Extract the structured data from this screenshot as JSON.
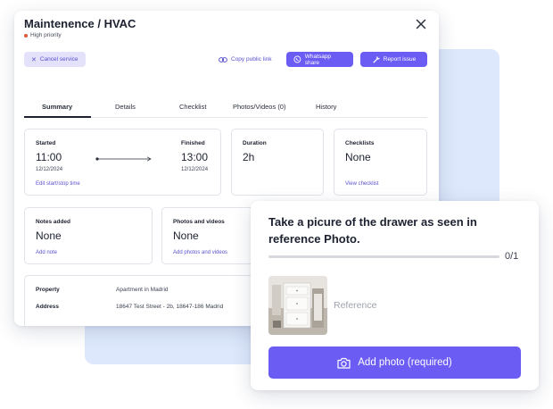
{
  "main": {
    "title": "Maintenence / HVAC",
    "priority": "High priority",
    "colors": {
      "accent": "#6b5cf3",
      "priority_dot": "#e0563a"
    },
    "actions": {
      "cancel": "Cancel service",
      "copy_link": "Copy public link",
      "whatsapp": "Whatsapp share",
      "report": "Report issue"
    },
    "tabs": [
      {
        "label": "Summary",
        "active": true
      },
      {
        "label": "Details",
        "active": false
      },
      {
        "label": "Checklist",
        "active": false
      },
      {
        "label": "Photos/Videos (0)",
        "active": false
      },
      {
        "label": "History",
        "active": false
      }
    ],
    "timing": {
      "started_label": "Started",
      "started_time": "11:00",
      "started_date": "12/12/2024",
      "finished_label": "Finished",
      "finished_time": "13:00",
      "finished_date": "12/12/2024",
      "edit_link": "Edit start/stop time"
    },
    "duration": {
      "label": "Duration",
      "value": "2h"
    },
    "checklists": {
      "label": "Checklists",
      "value": "None",
      "link": "View checklist"
    },
    "notes": {
      "label": "Notes added",
      "value": "None",
      "link": "Add note"
    },
    "photos": {
      "label": "Photos and videos",
      "value": "None",
      "link": "Add photos and videos"
    },
    "info": {
      "property_label": "Property",
      "property_value": "Apartment in Madrid",
      "address_label": "Address",
      "address_value": "18647 Test Street - 2b, 18647-186 Madrid"
    }
  },
  "task": {
    "instruction": "Take a picure of the drawer as seen in reference Photo.",
    "progress_text": "0/1",
    "progress_fraction": 0,
    "reference_label": "Reference",
    "add_button": "Add photo (required)"
  }
}
